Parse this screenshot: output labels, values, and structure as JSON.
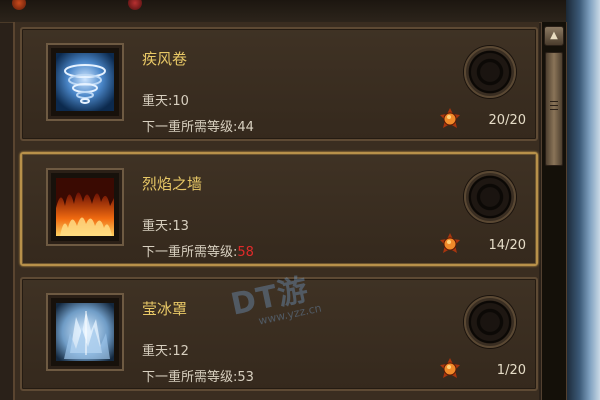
{
  "skills": [
    {
      "name": "疾风卷",
      "tier_label": "重天:",
      "tier_value": "10",
      "req_label": "下一重所需等级:",
      "req_value": "44",
      "count": "20/20"
    },
    {
      "name": "烈焰之墙",
      "tier_label": "重天:",
      "tier_value": "13",
      "req_label": "下一重所需等级:",
      "req_value": "58",
      "count": "14/20"
    },
    {
      "name": "莹冰罩",
      "tier_label": "重天:",
      "tier_value": "12",
      "req_label": "下一重所需等级:",
      "req_value": "53",
      "count": "1/20"
    }
  ],
  "icons": {
    "skill_icons": [
      "whirlwind-icon",
      "firewall-icon",
      "ice-shield-icon"
    ],
    "gem": "orange-gem-icon",
    "scroll_up": "up-arrow-icon"
  },
  "colors": {
    "skill_name": "#e8c866",
    "warning_value": "#e02a2a",
    "selected_border": "#b8914a"
  },
  "watermark": {
    "logo": "DT游",
    "url": "www.yzz.cn"
  }
}
